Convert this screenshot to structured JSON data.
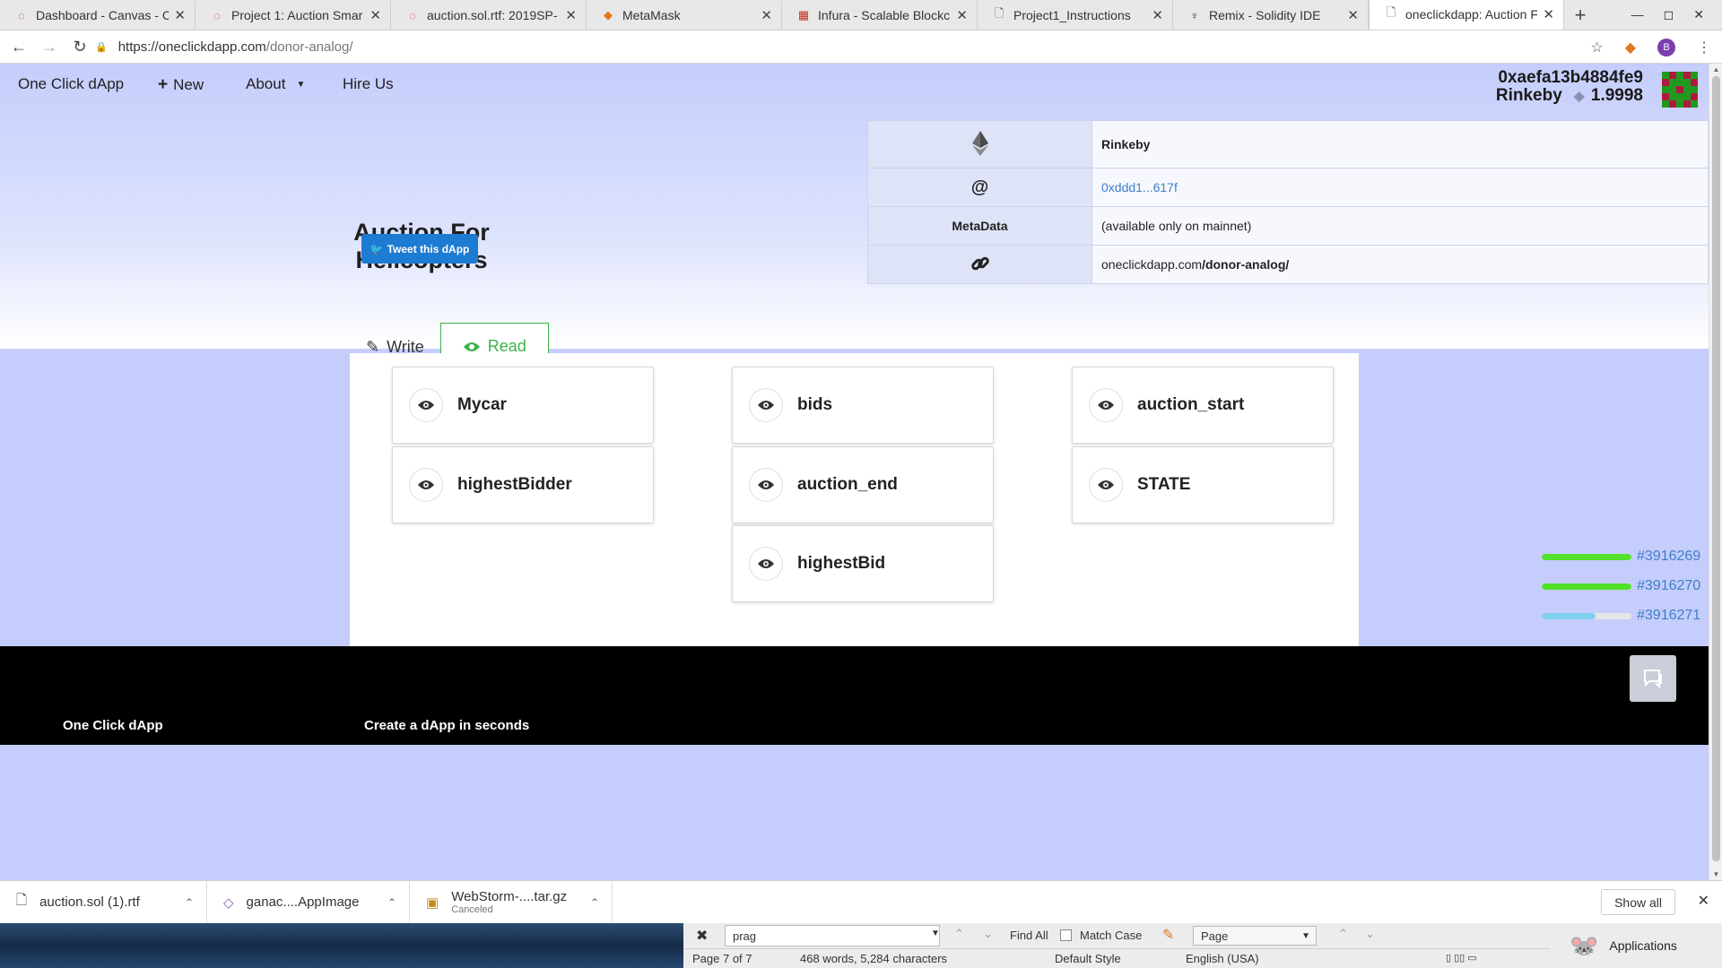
{
  "browser": {
    "tabs": [
      {
        "title": "Dashboard - Canvas - C",
        "icon": "canvas-icon"
      },
      {
        "title": "Project 1: Auction Smar",
        "icon": "canvas-icon"
      },
      {
        "title": "auction.sol.rtf: 2019SP-",
        "icon": "canvas-icon"
      },
      {
        "title": "MetaMask",
        "icon": "metamask-icon"
      },
      {
        "title": "Infura - Scalable Blockc",
        "icon": "infura-icon"
      },
      {
        "title": "Project1_Instructions",
        "icon": "document-icon"
      },
      {
        "title": "Remix - Solidity IDE",
        "icon": "remix-icon"
      },
      {
        "title": "oneclickdapp: Auction F",
        "icon": "document-icon",
        "active": true
      }
    ],
    "url_host": "https://oneclickdapp.com",
    "url_path": "/donor-analog/",
    "profile_initial": "B"
  },
  "nav": {
    "brand": "One Click dApp",
    "new_label": "New",
    "about_label": "About",
    "hire_label": "Hire Us"
  },
  "account": {
    "address": "0xaefa13b4884fe9",
    "network": "Rinkeby",
    "balance": "1.9998"
  },
  "dapp": {
    "title": "Auction For Helicopters",
    "tweet_label": "Tweet this dApp"
  },
  "info": {
    "network": "Rinkeby",
    "contract_address": "0xddd1...617f",
    "metadata_key": "MetaData",
    "metadata_value": "(available only on mainnet)",
    "link_host": "oneclickdapp.com",
    "link_path": "/donor-analog/"
  },
  "tabs": {
    "write": "Write",
    "read": "Read"
  },
  "functions": [
    "Mycar",
    "bids",
    "auction_start",
    "highestBidder",
    "auction_end",
    "STATE",
    "highestBid"
  ],
  "pending_blocks": [
    {
      "label": "#3916269",
      "progress": 1.0,
      "color": "#52e12a"
    },
    {
      "label": "#3916270",
      "progress": 1.0,
      "color": "#52e12a"
    },
    {
      "label": "#3916271",
      "progress": 0.6,
      "color": "#7fcfef"
    }
  ],
  "footer": {
    "col1": "One Click dApp",
    "col2": "Create a dApp in seconds"
  },
  "downloads": {
    "items": [
      {
        "name": "auction.sol (1).rtf",
        "sub": ""
      },
      {
        "name": "ganac....AppImage",
        "sub": ""
      },
      {
        "name": "WebStorm-....tar.gz",
        "sub": "Canceled"
      }
    ],
    "show_all": "Show all"
  },
  "findbar": {
    "query": "prag",
    "find_all": "Find All",
    "match_case": "Match Case",
    "page_select": "Page"
  },
  "status": {
    "page": "Page 7 of 7",
    "words": "468 words, 5,284 characters",
    "style": "Default Style",
    "language": "English (USA)"
  },
  "taskbar": {
    "applications": "Applications"
  }
}
